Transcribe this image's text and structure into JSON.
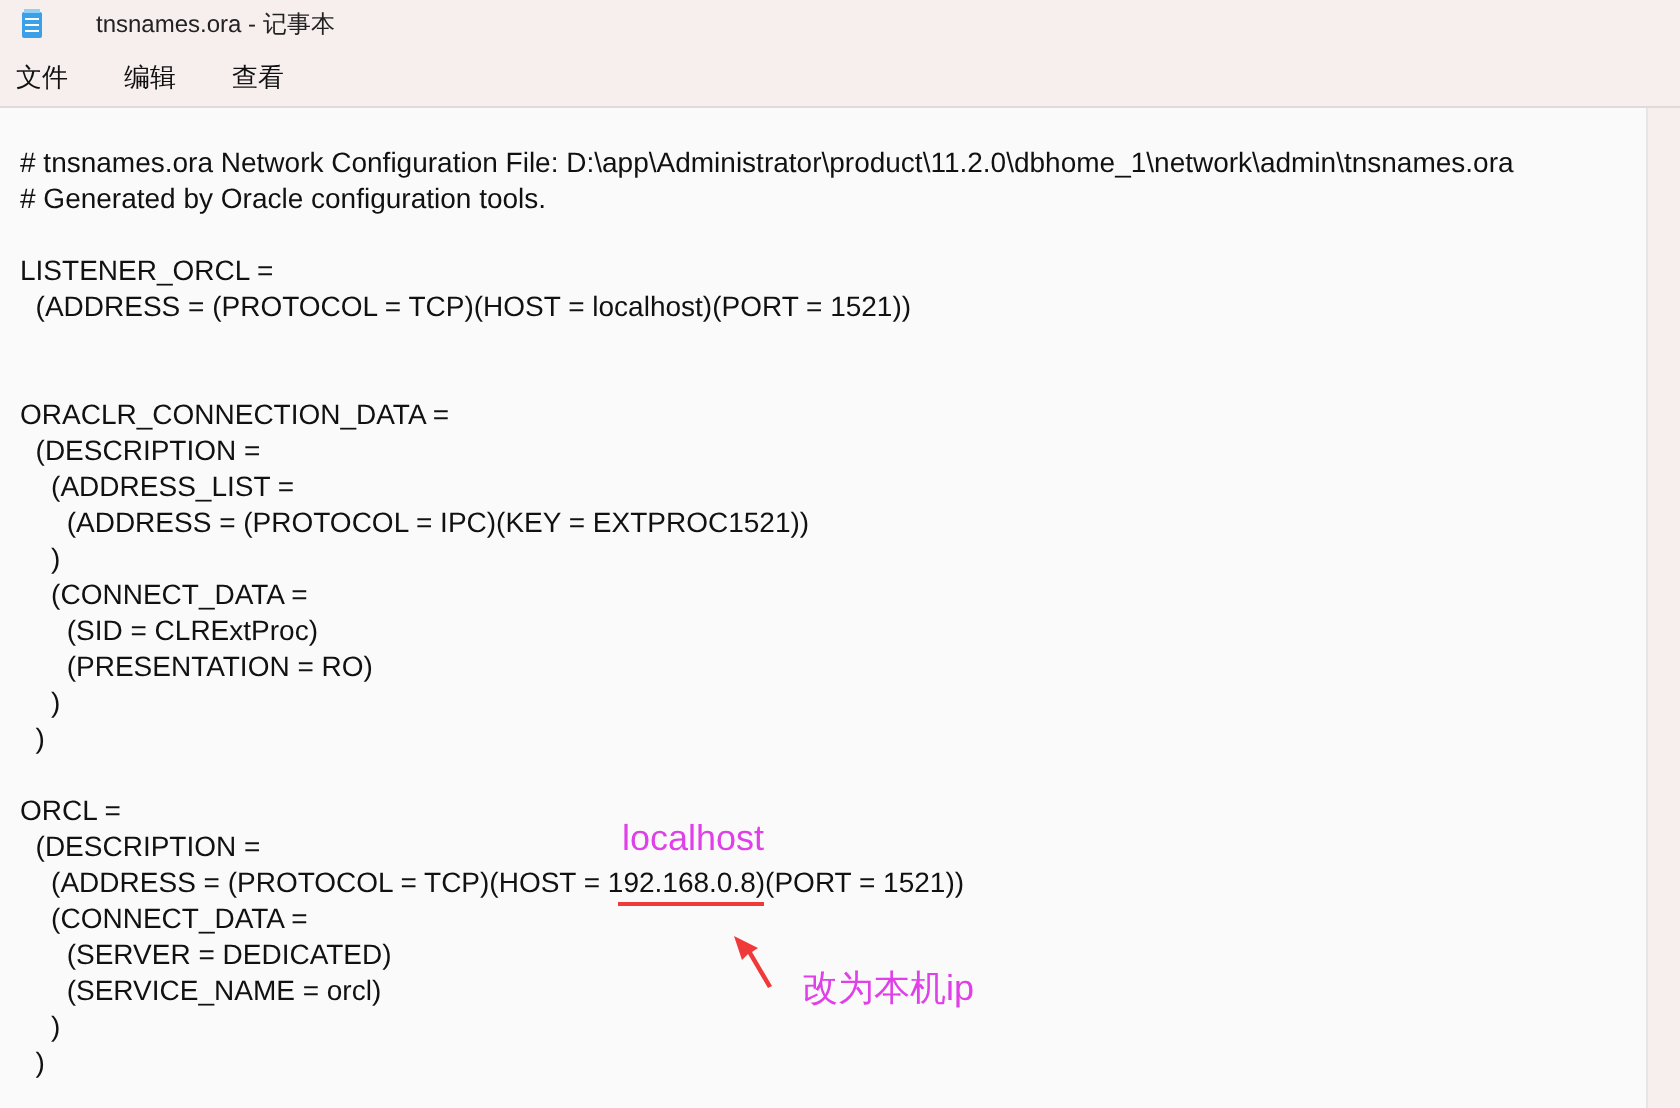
{
  "window": {
    "title": "tnsnames.ora - 记事本"
  },
  "menu": [
    {
      "label": "文件"
    },
    {
      "label": "编辑"
    },
    {
      "label": "查看"
    }
  ],
  "document": {
    "blocks": [
      {
        "lines": [
          "# tnsnames.ora Network Configuration File: D:\\app\\Administrator\\product\\11.2.0\\dbhome_1\\network\\admin\\tnsnames.ora",
          "# Generated by Oracle configuration tools."
        ]
      },
      {
        "lines": [
          "LISTENER_ORCL =",
          "  (ADDRESS = (PROTOCOL = TCP)(HOST = localhost)(PORT = 1521))"
        ]
      },
      {
        "lines": [
          "ORACLR_CONNECTION_DATA =",
          "  (DESCRIPTION =",
          "    (ADDRESS_LIST =",
          "      (ADDRESS = (PROTOCOL = IPC)(KEY = EXTPROC1521))",
          "    )",
          "    (CONNECT_DATA =",
          "      (SID = CLRExtProc)",
          "      (PRESENTATION = RO)",
          "    )",
          "  )"
        ]
      },
      {
        "lines": [
          "ORCL =",
          "  (DESCRIPTION =",
          "    (ADDRESS = (PROTOCOL = TCP)(HOST = 192.168.0.8)(PORT = 1521))",
          "    (CONNECT_DATA =",
          "      (SERVER = DEDICATED)",
          "      (SERVICE_NAME = orcl)",
          "    )",
          "  )"
        ]
      }
    ]
  },
  "annotation": {
    "replacement": "localhost",
    "note": "改为本机ip"
  }
}
